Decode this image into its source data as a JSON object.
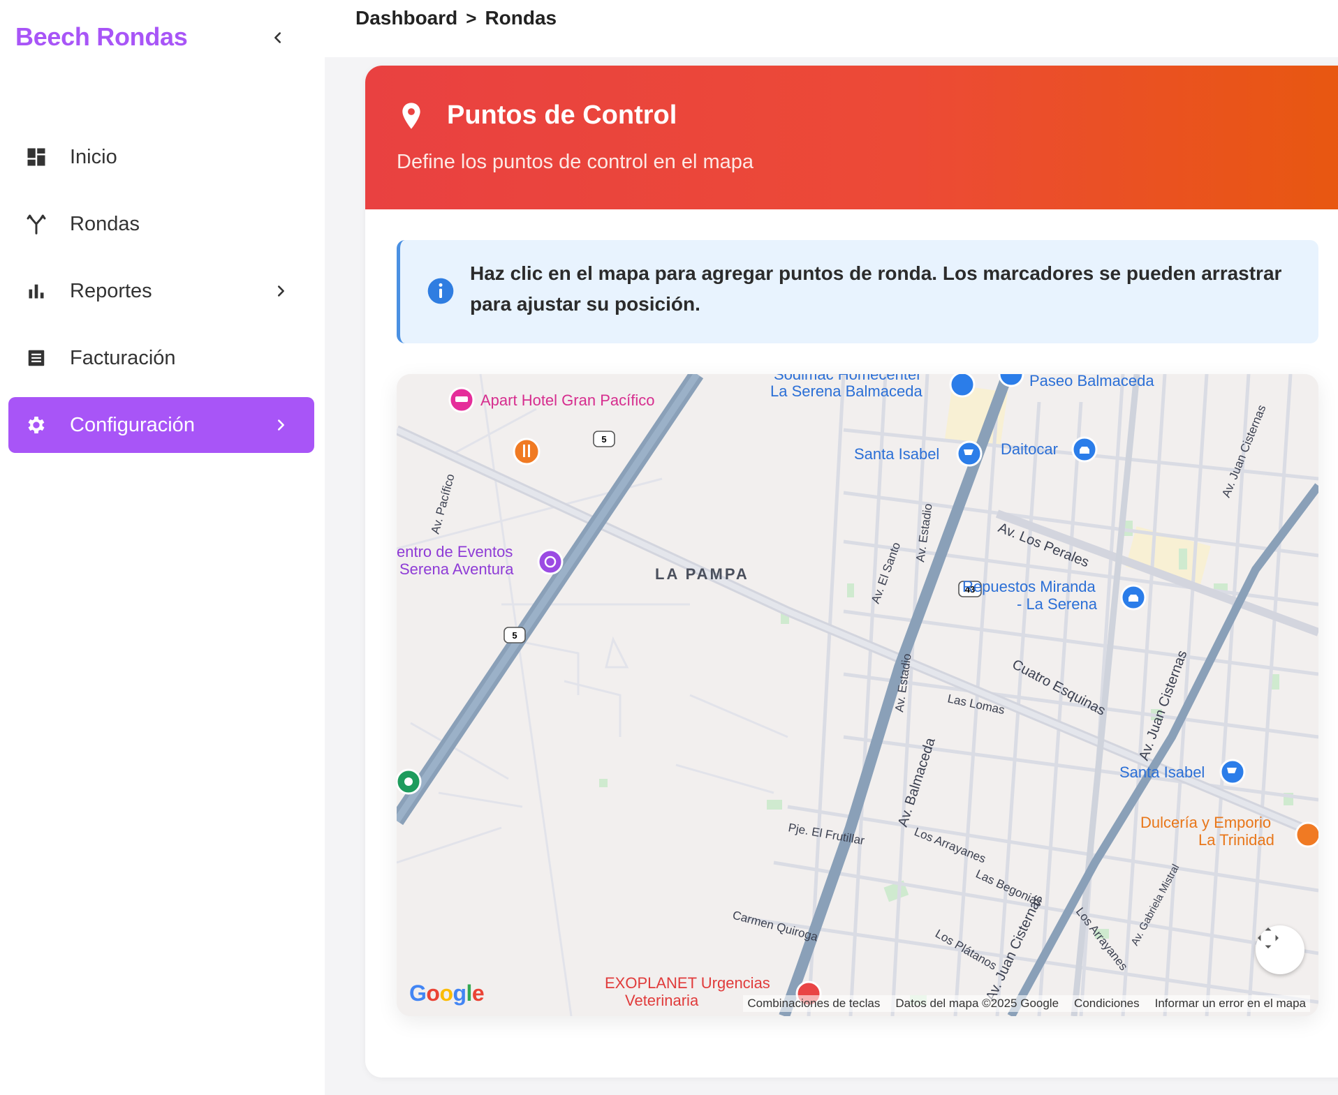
{
  "sidebar": {
    "brand": "Beech Rondas",
    "items": [
      {
        "label": "Inicio",
        "icon": "dashboard-icon",
        "active": false,
        "has_chevron": false
      },
      {
        "label": "Rondas",
        "icon": "route-icon",
        "active": false,
        "has_chevron": false
      },
      {
        "label": "Reportes",
        "icon": "bar-chart-icon",
        "active": false,
        "has_chevron": true
      },
      {
        "label": "Facturación",
        "icon": "receipt-icon",
        "active": false,
        "has_chevron": false
      },
      {
        "label": "Configuración",
        "icon": "gear-icon",
        "active": true,
        "has_chevron": true
      }
    ]
  },
  "breadcrumb": {
    "items": [
      "Dashboard",
      "Rondas"
    ],
    "separator": ">"
  },
  "card": {
    "title": "Puntos de Control",
    "subtitle": "Define los puntos de control en el mapa",
    "info": "Haz clic en el mapa para agregar puntos de ronda. Los marcadores se pueden arrastrar para ajustar su posición."
  },
  "map": {
    "area_label": "LA PAMPA",
    "pois": {
      "apart_hotel": "Apart Hotel Gran Pacífico",
      "sodimac_1": "Sodimac Homecenter",
      "sodimac_2": "La Serena Balmaceda",
      "paseo": "Paseo Balmaceda",
      "santa_isabel_1": "Santa Isabel",
      "daitocar": "Daitocar",
      "centro_1": "entro de Eventos",
      "centro_2": "Serena Aventura",
      "repuestos_1": "Repuestos Miranda",
      "repuestos_2": "- La Serena",
      "santa_isabel_2": "Santa Isabel",
      "dulceria_1": "Dulcería y Emporio",
      "dulceria_2": "La Trinidad",
      "exoplanet_1": "EXOPLANET Urgencias",
      "exoplanet_2": "Veterinaria"
    },
    "streets": {
      "pacifico": "Av. Pacífico",
      "estadio_1": "Av. Estadio",
      "estadio_2": "Av. Estadio",
      "el_santo": "Av. El Santo",
      "los_perales": "Av. Los Perales",
      "cuatro_esquinas": "Cuatro Esquinas",
      "las_lomas": "Las Lomas",
      "balmaceda": "Av. Balmaceda",
      "juan_cisternas_1": "Av. Juan Cisternas",
      "juan_cisternas_2": "Av. Juan Cisternas",
      "juan_cisternas_3": "Av. Juan Cisternas",
      "el_frutillar": "Pje. El Frutillar",
      "los_arrayanes_1": "Los Arrayanes",
      "los_arrayanes_2": "Los Arrayanes",
      "las_begonias": "Las Begonias",
      "carmen_quiroga": "Carmen Quiroga",
      "los_platanos": "Los Plátanos",
      "gabriela_mistral": "Av. Gabriela Mistral",
      "route_5": "5",
      "route_43": "43"
    },
    "footer": {
      "shortcuts": "Combinaciones de teclas",
      "data": "Datos del mapa ©2025 Google",
      "terms": "Condiciones",
      "report": "Informar un error en el mapa"
    },
    "logo": "Google"
  },
  "colors": {
    "brand": "#a855f7",
    "header_start": "#e94141",
    "header_end": "#e8580f",
    "info_bg": "#e8f3fe",
    "info_accent": "#4a90e2"
  }
}
